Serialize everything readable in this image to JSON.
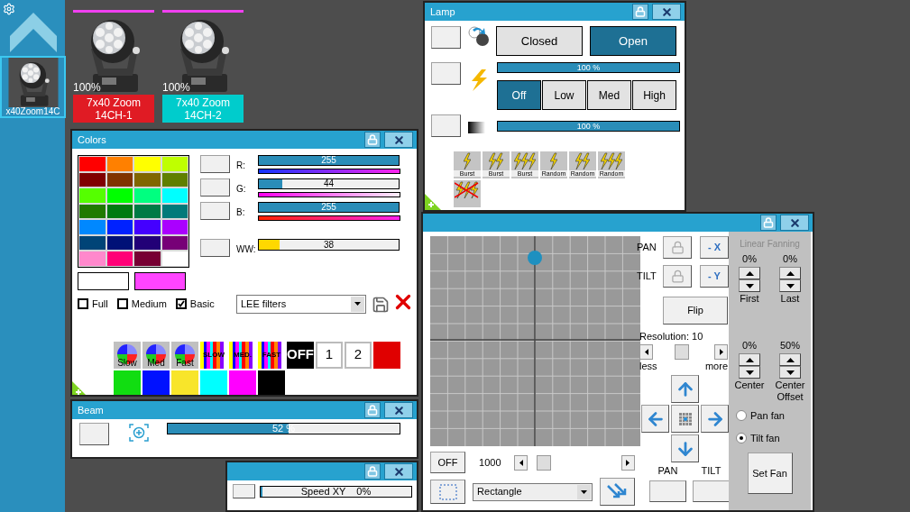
{
  "sidebar": {
    "fixture": {
      "label": "x40Zoom14C",
      "selected": true
    }
  },
  "fixtures": [
    {
      "intensity": "100%",
      "name": "7x40 Zoom 14CH-1",
      "color": "#e01b24"
    },
    {
      "intensity": "100%",
      "name": "7x40 Zoom 14CH-2",
      "color": "#00cccc"
    }
  ],
  "colors": {
    "title": "Colors",
    "palette": [
      {
        "color": "#ff0000"
      },
      {
        "color": "#ff8000"
      },
      {
        "color": "#ffff00"
      },
      {
        "color": "#bfff00"
      },
      {
        "color": "#800000"
      },
      {
        "color": "#803300"
      },
      {
        "color": "#806600"
      },
      {
        "color": "#5f7f00"
      },
      {
        "color": "#55ff00"
      },
      {
        "color": "#00ff00"
      },
      {
        "color": "#00ff80"
      },
      {
        "color": "#00ffff"
      },
      {
        "color": "#207a00"
      },
      {
        "color": "#007a10"
      },
      {
        "color": "#007a45"
      },
      {
        "color": "#007a7a"
      },
      {
        "color": "#0088ff"
      },
      {
        "color": "#0022ff"
      },
      {
        "color": "#4400ff"
      },
      {
        "color": "#aa00ff"
      },
      {
        "color": "#004477"
      },
      {
        "color": "#001177"
      },
      {
        "color": "#220077"
      },
      {
        "color": "#770077"
      },
      {
        "color": "#ff88cc"
      },
      {
        "color": "#ff0077"
      },
      {
        "color": "#770033"
      },
      {
        "color": "#ffffff"
      }
    ],
    "swatches": [
      {
        "color": "#ffffff"
      },
      {
        "color": "#ff44ff"
      }
    ],
    "modes": [
      {
        "label": "Full",
        "checked": false
      },
      {
        "label": "Medium",
        "checked": false
      },
      {
        "label": "Basic",
        "checked": true
      }
    ],
    "channels": [
      {
        "kind": "color",
        "label": "R:",
        "value": "255",
        "level": 1
      },
      {
        "kind": "color",
        "label": "G:",
        "value": "44",
        "level": 0.17
      },
      {
        "kind": "color",
        "label": "B:",
        "value": "255",
        "level": 1
      },
      {
        "kind": "white",
        "label": "WW:",
        "value": "38",
        "level": 0.15
      }
    ],
    "filter": "LEE filters",
    "effects": [
      {
        "kind": "wheel",
        "label": "Slow"
      },
      {
        "kind": "wheel",
        "label": "Med"
      },
      {
        "kind": "wheel",
        "label": "Fast"
      },
      {
        "kind": "stripes",
        "label": "SLOW"
      },
      {
        "kind": "stripes",
        "label": "MED."
      },
      {
        "kind": "stripes",
        "label": "FAST"
      },
      {
        "kind": "off",
        "label": "OFF"
      },
      {
        "kind": "number",
        "label": "1"
      },
      {
        "kind": "number",
        "label": "2"
      },
      {
        "kind": "color",
        "color": "#e00000"
      },
      {
        "kind": "color",
        "color": "#11dd11"
      },
      {
        "kind": "color",
        "color": "#0011ff"
      },
      {
        "kind": "color",
        "color": "#f8e52a"
      },
      {
        "kind": "color",
        "color": "#00ffff"
      },
      {
        "kind": "color",
        "color": "#ff00ff"
      },
      {
        "kind": "color",
        "color": "#000000"
      }
    ]
  },
  "lamp": {
    "title": "Lamp",
    "shutter": [
      {
        "label": "Closed",
        "selected": false
      },
      {
        "label": "Open",
        "selected": true
      }
    ],
    "strobe_rate": {
      "value": "100 %",
      "level": 1
    },
    "strobe": [
      {
        "label": "Off",
        "selected": true
      },
      {
        "label": "Low",
        "selected": false
      },
      {
        "label": "Med",
        "selected": false
      },
      {
        "label": "High",
        "selected": false
      }
    ],
    "dimmer": {
      "value": "100 %",
      "level": 1
    },
    "effects": [
      {
        "kind": "one",
        "label": "Burst"
      },
      {
        "kind": "two",
        "label": "Burst"
      },
      {
        "kind": "three",
        "label": "Burst"
      },
      {
        "kind": "one",
        "label": "Random"
      },
      {
        "kind": "two",
        "label": "Random"
      },
      {
        "kind": "three",
        "label": "Random"
      },
      {
        "kind": "cancel"
      }
    ]
  },
  "position": {
    "axes": [
      {
        "label": "PAN",
        "invert": "- X"
      },
      {
        "label": "TILT",
        "invert": "- Y"
      }
    ],
    "flip": "Flip",
    "resolution": "Resolution: 10",
    "less": "less",
    "more": "more",
    "off": "OFF",
    "speed": "1000",
    "shape": "Rectangle",
    "outputs": [
      "PAN",
      "TILT"
    ],
    "fanning": {
      "title": "Linear Fanning",
      "values": [
        {
          "value": "0%",
          "label": "First"
        },
        {
          "value": "0%",
          "label": "Last"
        },
        {
          "value": "0%",
          "label": "Center"
        },
        {
          "value": "50%",
          "label": "Center Offset"
        }
      ],
      "modes": [
        {
          "label": "Pan fan",
          "selected": false
        },
        {
          "label": "Tilt fan",
          "selected": true
        }
      ],
      "button": "Set Fan"
    }
  },
  "beam": {
    "title": "Beam",
    "value": "52 %",
    "level": 0.52
  },
  "speed": {
    "value": "Speed XY    0%",
    "level": 0
  }
}
